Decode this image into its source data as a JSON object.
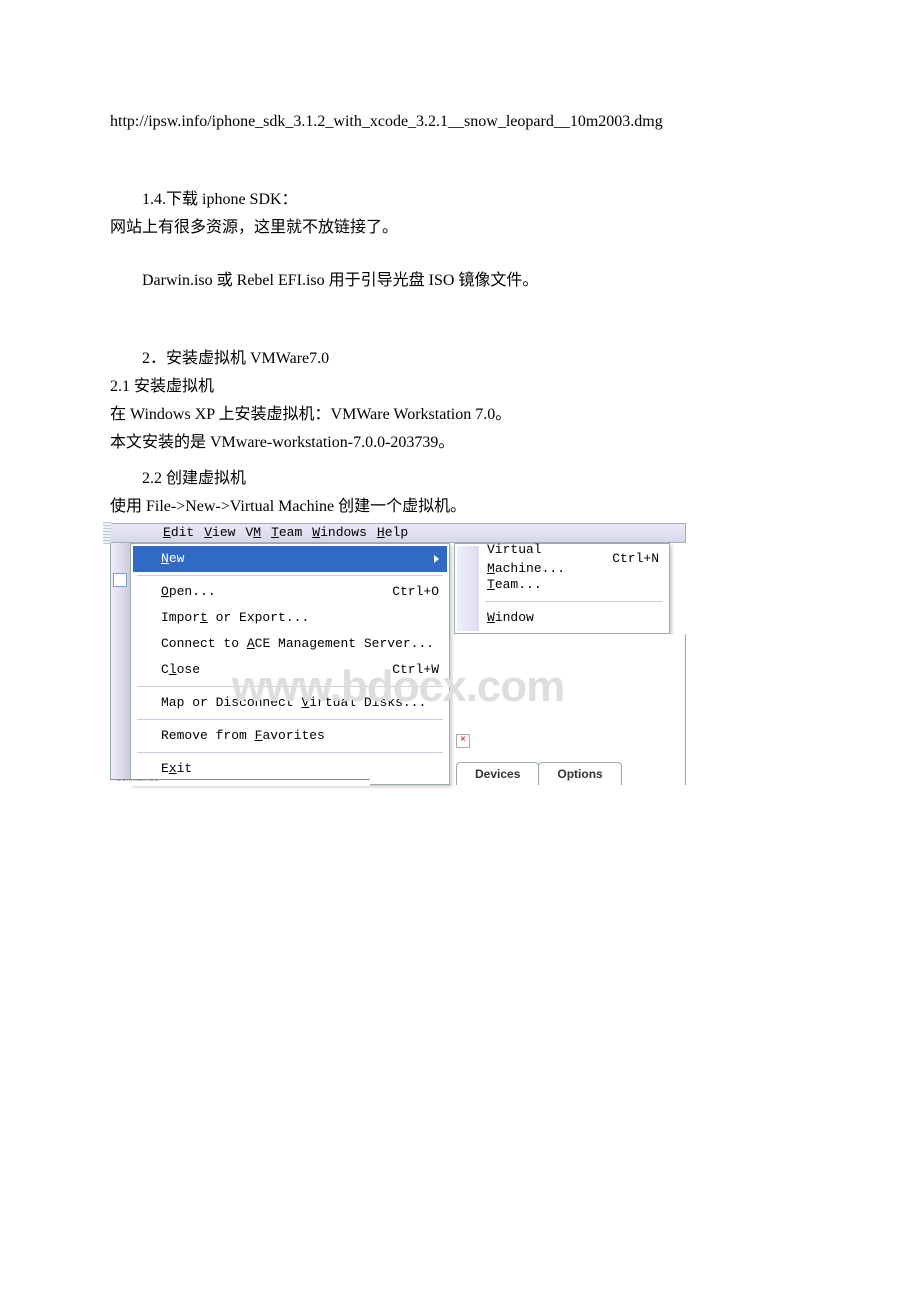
{
  "doc": {
    "url": "http://ipsw.info/iphone_sdk_3.1.2_with_xcode_3.2.1__snow_leopard__10m2003.dmg",
    "sec14": "1.4.下载 iphone SDK：",
    "line14_a": "网站上有很多资源，这里就不放链接了。",
    "line14_b": "Darwin.iso 或 Rebel EFI.iso 用于引导光盘 ISO 镜像文件。",
    "sec2": "2．安装虚拟机 VMWare7.0",
    "sec21": "2.1 安装虚拟机",
    "line21_a": "在 Windows XP 上安装虚拟机：VMWare Workstation 7.0。",
    "line21_b": "本文安装的是 VMware-workstation-7.0.0-203739。",
    "sec22": "2.2 创建虚拟机",
    "line22_a": "使用 File->New->Virtual Machine 创建一个虚拟机。"
  },
  "menubar": {
    "edit": {
      "u": "E",
      "rest": "dit"
    },
    "view": {
      "u": "V",
      "rest": "iew"
    },
    "vm": {
      "pre": "V",
      "u": "M",
      "rest": ""
    },
    "team": {
      "u": "T",
      "rest": "eam"
    },
    "windows": {
      "u": "W",
      "rest": "indows"
    },
    "help": {
      "u": "H",
      "rest": "elp"
    }
  },
  "menu": {
    "new": {
      "u": "N",
      "rest": "ew"
    },
    "open": {
      "u": "O",
      "rest": "pen..."
    },
    "open_sc": "Ctrl+O",
    "import": {
      "pre": "Impor",
      "u": "t",
      "rest": " or Export..."
    },
    "connect": {
      "pre": "Connect to ",
      "u": "A",
      "rest": "CE Management Server..."
    },
    "close": {
      "pre": "C",
      "u": "l",
      "rest": "ose"
    },
    "close_sc": "Ctrl+W",
    "map": {
      "pre": "Map or Disconnect ",
      "u": "V",
      "rest": "irtual Disks..."
    },
    "remove": {
      "pre": "Remove from ",
      "u": "F",
      "rest": "avorites"
    },
    "exit": {
      "pre": "E",
      "u": "x",
      "rest": "it"
    }
  },
  "submenu": {
    "vm": {
      "pre": "Virtual ",
      "u": "M",
      "rest": "achine..."
    },
    "vm_sc": "Ctrl+N",
    "team": {
      "u": "T",
      "rest": "eam..."
    },
    "window": {
      "u": "W",
      "rest": "indow"
    }
  },
  "tabs": {
    "devices": "Devices",
    "options": "Options"
  },
  "watermark": "www.bdocx.com",
  "cutoff": "Commands"
}
